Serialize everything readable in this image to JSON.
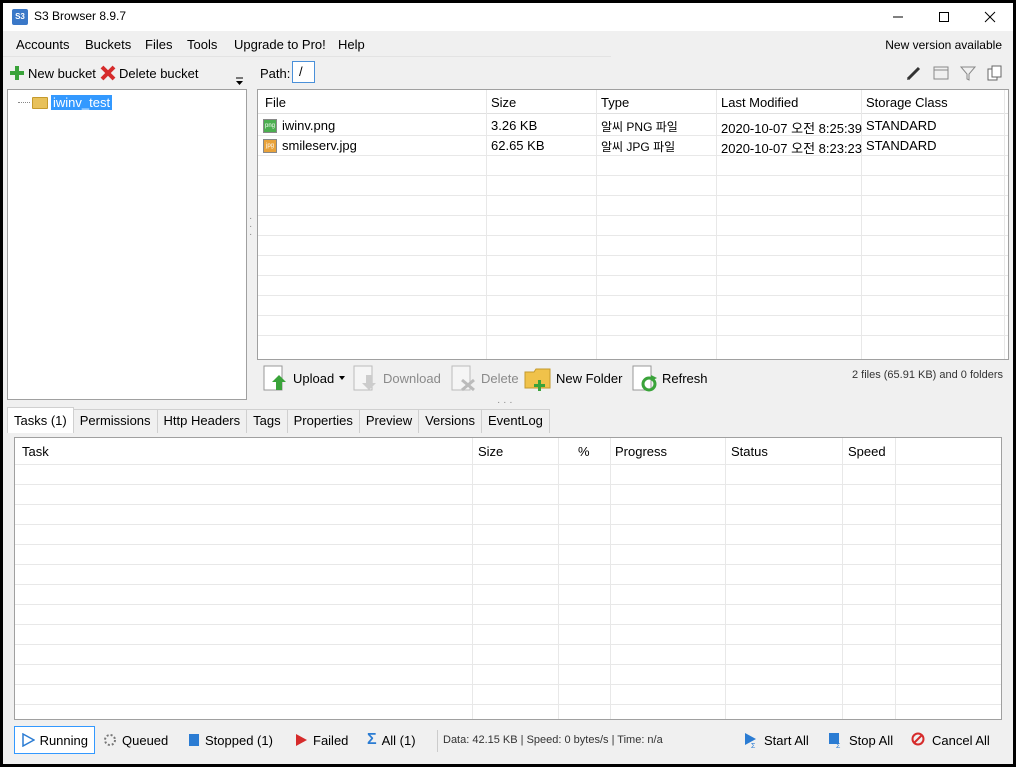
{
  "window": {
    "title": "S3 Browser 8.9.7",
    "app_icon_text": "S3"
  },
  "menu": {
    "items": [
      "Accounts",
      "Buckets",
      "Files",
      "Tools",
      "Upgrade to Pro!",
      "Help"
    ],
    "new_version": "New version available"
  },
  "bucket_toolbar": {
    "new_bucket": "New bucket",
    "delete_bucket": "Delete bucket"
  },
  "tree": {
    "items": [
      {
        "label": "iwinv_test",
        "selected": true
      }
    ]
  },
  "path": {
    "label": "Path:",
    "value": "/"
  },
  "file_list": {
    "columns": [
      "File",
      "Size",
      "Type",
      "Last Modified",
      "Storage Class"
    ],
    "rows": [
      {
        "icon": "png-file-icon",
        "icon_text": "png",
        "name": "iwinv.png",
        "size": "3.26 KB",
        "type": "알씨 PNG 파일",
        "modified": "2020-10-07 오전 8:25:39",
        "storage": "STANDARD"
      },
      {
        "icon": "jpg-file-icon",
        "icon_text": "jpg",
        "name": "smileserv.jpg",
        "size": "62.65 KB",
        "type": "알씨 JPG 파일",
        "modified": "2020-10-07 오전 8:23:23",
        "storage": "STANDARD"
      }
    ]
  },
  "file_actions": {
    "upload": "Upload",
    "download": "Download",
    "delete": "Delete",
    "new_folder": "New Folder",
    "refresh": "Refresh",
    "summary": "2 files (65.91 KB) and 0 folders"
  },
  "tabs": [
    "Tasks (1)",
    "Permissions",
    "Http Headers",
    "Tags",
    "Properties",
    "Preview",
    "Versions",
    "EventLog"
  ],
  "tasks": {
    "columns": [
      "Task",
      "Size",
      "%",
      "Progress",
      "Status",
      "Speed"
    ]
  },
  "statusbar": {
    "running": "Running",
    "queued": "Queued",
    "stopped": "Stopped (1)",
    "failed": "Failed",
    "all": "All (1)",
    "info": "Data: 42.15 KB | Speed: 0 bytes/s | Time: n/a",
    "start_all": "Start All",
    "stop_all": "Stop All",
    "cancel_all": "Cancel All"
  },
  "colors": {
    "selection": "#3399ff",
    "grid_line": "#e8e8e8",
    "panel_bg": "#f0f0f0"
  }
}
